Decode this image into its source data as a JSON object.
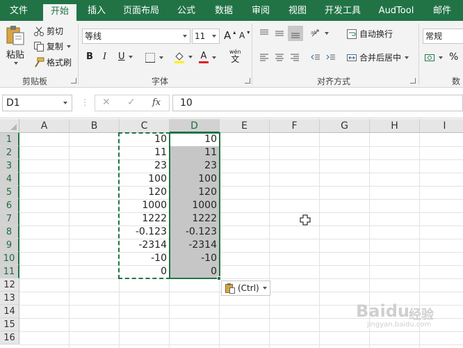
{
  "ribbon_tabs": [
    "文件",
    "开始",
    "插入",
    "页面布局",
    "公式",
    "数据",
    "审阅",
    "视图",
    "开发工具",
    "AudTool",
    "邮件"
  ],
  "active_tab": "开始",
  "clipboard": {
    "paste_label": "粘贴",
    "cut_label": "剪切",
    "copy_label": "复制",
    "format_painter_label": "格式刷",
    "group_label": "剪贴板"
  },
  "font": {
    "font_name": "等线",
    "font_size": "11",
    "bold": "B",
    "italic": "I",
    "underline": "U",
    "grow": "A",
    "shrink": "A",
    "phonetic_top": "wén",
    "phonetic_bottom": "文",
    "font_color_glyph": "A",
    "group_label": "字体"
  },
  "alignment": {
    "wrap_text_label": "自动换行",
    "merge_center_label": "合并后居中",
    "group_label": "对齐方式"
  },
  "number": {
    "format": "常规",
    "percent": "%",
    "group_label": "数"
  },
  "formula_bar": {
    "name_box": "D1",
    "fx_label": "fx",
    "cancel": "✕",
    "confirm": "✓",
    "value": "10"
  },
  "columns": [
    "A",
    "B",
    "C",
    "D",
    "E",
    "F",
    "G",
    "H",
    "I"
  ],
  "rows": [
    "1",
    "2",
    "3",
    "4",
    "5",
    "6",
    "7",
    "8",
    "9",
    "10",
    "11",
    "12",
    "13",
    "14",
    "15",
    "16"
  ],
  "column_c_values": [
    "10",
    "11",
    "23",
    "100",
    "120",
    "1000",
    "1222",
    "-0.123",
    "-2314",
    "-10",
    "0"
  ],
  "column_d_values": [
    "10",
    "11",
    "23",
    "100",
    "120",
    "1000",
    "1222",
    "-0.123",
    "-2314",
    "-10",
    "0"
  ],
  "paste_options_label": "(Ctrl)",
  "watermark": {
    "brand": "Baidu",
    "sub": "经验",
    "url": "jingyan.baidu.com"
  },
  "colors": {
    "excel_green": "#217346",
    "selection_gray": "#c6c6c6",
    "header_gray": "#e6e6e6"
  }
}
